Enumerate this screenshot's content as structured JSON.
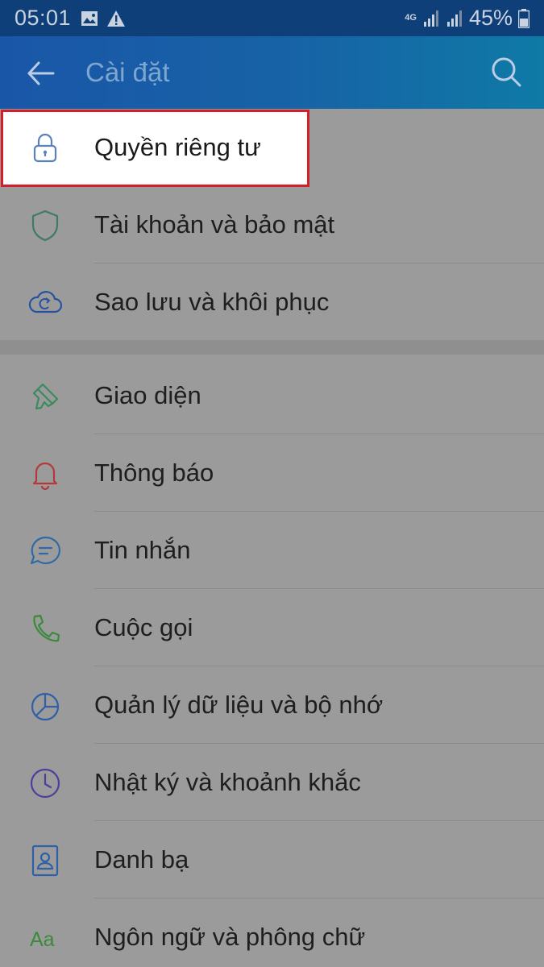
{
  "status_bar": {
    "time": "05:01",
    "network": "4G",
    "battery": "45%"
  },
  "app_bar": {
    "title": "Cài đặt"
  },
  "settings": [
    {
      "label": "Quyền riêng tư",
      "icon": "lock-icon",
      "color": "#5a82b8",
      "highlighted": true
    },
    {
      "label": "Tài khoản và bảo mật",
      "icon": "shield-icon",
      "color": "#3f7a66"
    },
    {
      "label": "Sao lưu và khôi phục",
      "icon": "cloud-sync-icon",
      "color": "#2553a0"
    },
    {
      "label": "Giao diện",
      "icon": "paint-brush-icon",
      "color": "#3b8a5e"
    },
    {
      "label": "Thông báo",
      "icon": "bell-icon",
      "color": "#b23a3a"
    },
    {
      "label": "Tin nhắn",
      "icon": "chat-icon",
      "color": "#2e6aa8"
    },
    {
      "label": "Cuộc gọi",
      "icon": "phone-icon",
      "color": "#3b8a3b"
    },
    {
      "label": "Quản lý dữ liệu và bộ nhớ",
      "icon": "pie-chart-icon",
      "color": "#2e5fa8"
    },
    {
      "label": "Nhật ký và khoảnh khắc",
      "icon": "clock-icon",
      "color": "#4b3f9e"
    },
    {
      "label": "Danh bạ",
      "icon": "contact-card-icon",
      "color": "#2e5fa8"
    },
    {
      "label": "Ngôn ngữ và phông chữ",
      "icon": "font-aa-icon",
      "color": "#3b8a3b"
    }
  ],
  "colors": {
    "highlight_border": "#d31f2a",
    "app_bar": "#1a56a8",
    "status_bar": "#0f3f78"
  }
}
